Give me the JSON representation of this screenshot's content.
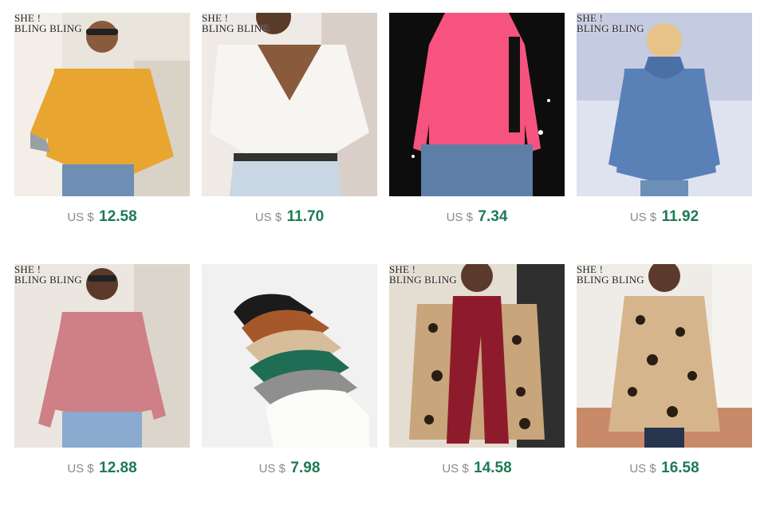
{
  "colors": {
    "price": "#1e7a54",
    "currency": "#8a8a8a"
  },
  "brand": {
    "line1": "SHE !",
    "line2": "BLING BLING"
  },
  "products": [
    {
      "currency": "US $",
      "price": "12.58",
      "desc": "mustard v-neck oversized sweater",
      "has_logo": true
    },
    {
      "currency": "US $",
      "price": "11.70",
      "desc": "white drawstring crop sweater",
      "has_logo": true
    },
    {
      "currency": "US $",
      "price": "7.34",
      "desc": "pink turtleneck top",
      "has_logo": false
    },
    {
      "currency": "US $",
      "price": "11.92",
      "desc": "blue cowl neck sweater",
      "has_logo": true
    },
    {
      "currency": "US $",
      "price": "12.88",
      "desc": "pink v-neck knit sweater",
      "has_logo": true
    },
    {
      "currency": "US $",
      "price": "7.98",
      "desc": "stack of mock neck sweaters",
      "has_logo": false
    },
    {
      "currency": "US $",
      "price": "14.58",
      "desc": "leopard sweater with red scarf",
      "has_logo": true
    },
    {
      "currency": "US $",
      "price": "16.58",
      "desc": "leopard print cardigan",
      "has_logo": true
    }
  ]
}
